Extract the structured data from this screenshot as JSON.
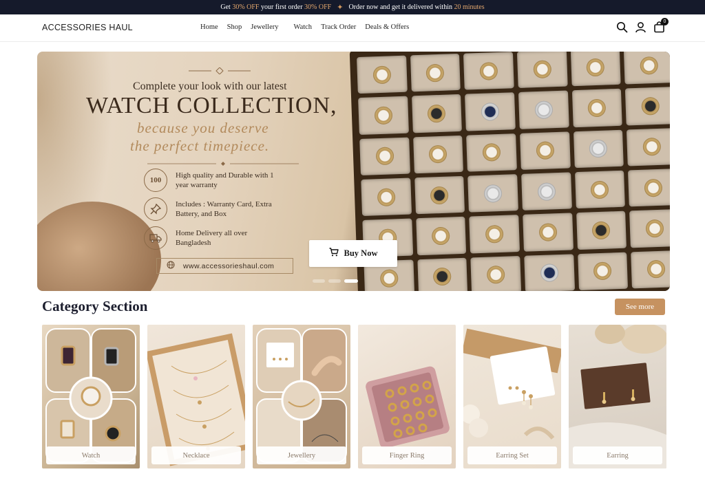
{
  "announcement": {
    "part1_pre": "Get",
    "part1_hl": "30% OFF",
    "part1_mid": "your first order",
    "part1_hl2": "30% OFF",
    "part2_pre": "Order now and get it delivered within",
    "part2_hl": "20 minutes"
  },
  "header": {
    "logo": "ACCESSORIES HAUL",
    "nav": [
      "Home",
      "Shop",
      "Jewellery",
      "Watch",
      "Track Order",
      "Deals & Offers"
    ],
    "cart_count": "0",
    "icons": [
      "search-icon",
      "user-icon",
      "cart-icon"
    ]
  },
  "hero": {
    "subtitle": "Complete your look with our latest",
    "title": "WATCH COLLECTION,",
    "script_line1": "because you deserve",
    "script_line2": "the perfect timepiece.",
    "features": [
      {
        "icon": "100",
        "text": "High quality and Durable with 1 year warranty"
      },
      {
        "icon": "pin",
        "text": "Includes : Warranty Card, Extra Battery, and Box"
      },
      {
        "icon": "truck",
        "text": "Home Delivery all over Bangladesh"
      }
    ],
    "url": "www.accessorieshaul.com",
    "buy_label": "Buy Now",
    "active_slide": 3,
    "slide_count": 3
  },
  "category_section": {
    "title": "Category Section",
    "see_more": "See more",
    "cards": [
      {
        "label": "Watch"
      },
      {
        "label": "Necklace"
      },
      {
        "label": "Jewellery"
      },
      {
        "label": "Finger Ring"
      },
      {
        "label": "Earring Set"
      },
      {
        "label": "Earring"
      }
    ]
  },
  "colors": {
    "topbar_bg": "#151a2b",
    "highlight": "#e4a86e",
    "accent_button": "#c69260",
    "heading": "#1c1e2e"
  }
}
